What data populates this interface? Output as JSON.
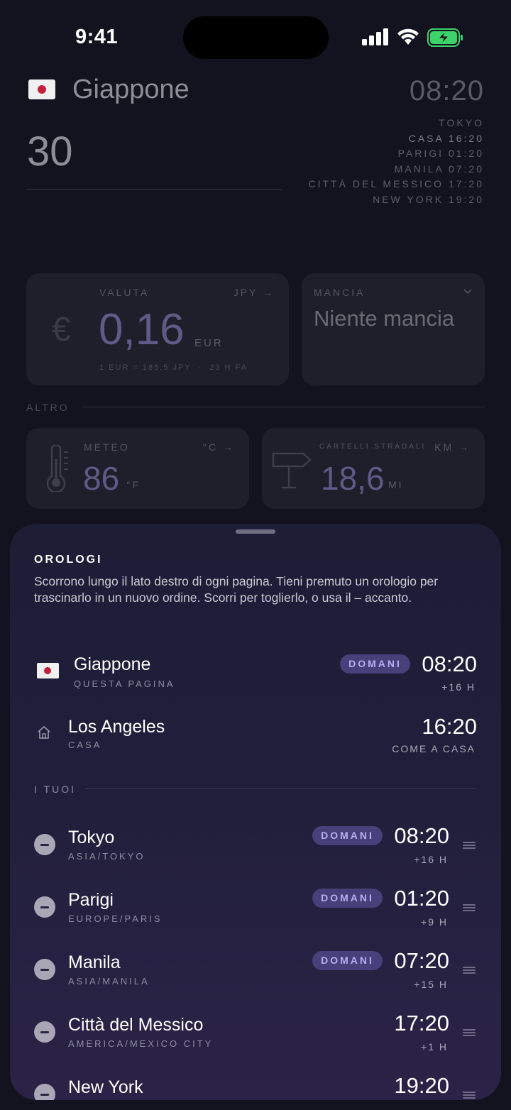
{
  "status_bar": {
    "time": "9:41"
  },
  "background_page": {
    "country": "Giappone",
    "amount": "30",
    "time": "08:20",
    "timezones": [
      {
        "label": "TOKYO",
        "time": ""
      },
      {
        "label": "CASA",
        "time": "16:20"
      },
      {
        "label": "PARIGI",
        "time": "01:20"
      },
      {
        "label": "MANILA",
        "time": "07:20"
      },
      {
        "label": "CITTÀ DEL MESSICO",
        "time": "17:20"
      },
      {
        "label": "NEW YORK",
        "time": "19:20"
      }
    ],
    "valuta": {
      "label": "VALUTA",
      "currency_code": "JPY →",
      "value": "0,16",
      "unit": "EUR",
      "rate": "1 EUR = 185,5 JPY  ·  23 H FA"
    },
    "mancia": {
      "label": "MANCIA",
      "value": "Niente mancia"
    },
    "altro_label": "ALTRO",
    "meteo": {
      "label": "METEO",
      "unit_toggle": "°C →",
      "value": "86",
      "unit": "°F"
    },
    "cartelli": {
      "label": "CARTELLI STRADALI",
      "unit_toggle": "KM →",
      "value": "18,6",
      "unit": "MI"
    }
  },
  "sheet": {
    "title": "OROLOGI",
    "description": "Scorrono lungo il lato destro di ogni pagina. Tieni premuto un orologio per trascinarlo in un nuovo ordine. Scorri per toglierlo, o usa il – accanto.",
    "current": {
      "title": "Giappone",
      "subtitle": "QUESTA PAGINA",
      "badge": "DOMANI",
      "time": "08:20",
      "offset": "+16 H"
    },
    "home": {
      "title": "Los Angeles",
      "subtitle": "CASA",
      "time": "16:20",
      "offset": "COME A CASA"
    },
    "section_label": "I TUOI",
    "clocks": [
      {
        "title": "Tokyo",
        "subtitle": "ASIA/TOKYO",
        "badge": "DOMANI",
        "time": "08:20",
        "offset": "+16 H"
      },
      {
        "title": "Parigi",
        "subtitle": "EUROPE/PARIS",
        "badge": "DOMANI",
        "time": "01:20",
        "offset": "+9 H"
      },
      {
        "title": "Manila",
        "subtitle": "ASIA/MANILA",
        "badge": "DOMANI",
        "time": "07:20",
        "offset": "+15 H"
      },
      {
        "title": "Città del Messico",
        "subtitle": "AMERICA/MEXICO CITY",
        "badge": "",
        "time": "17:20",
        "offset": "+1 H"
      },
      {
        "title": "New York",
        "subtitle": "",
        "badge": "",
        "time": "19:20",
        "offset": ""
      }
    ]
  }
}
